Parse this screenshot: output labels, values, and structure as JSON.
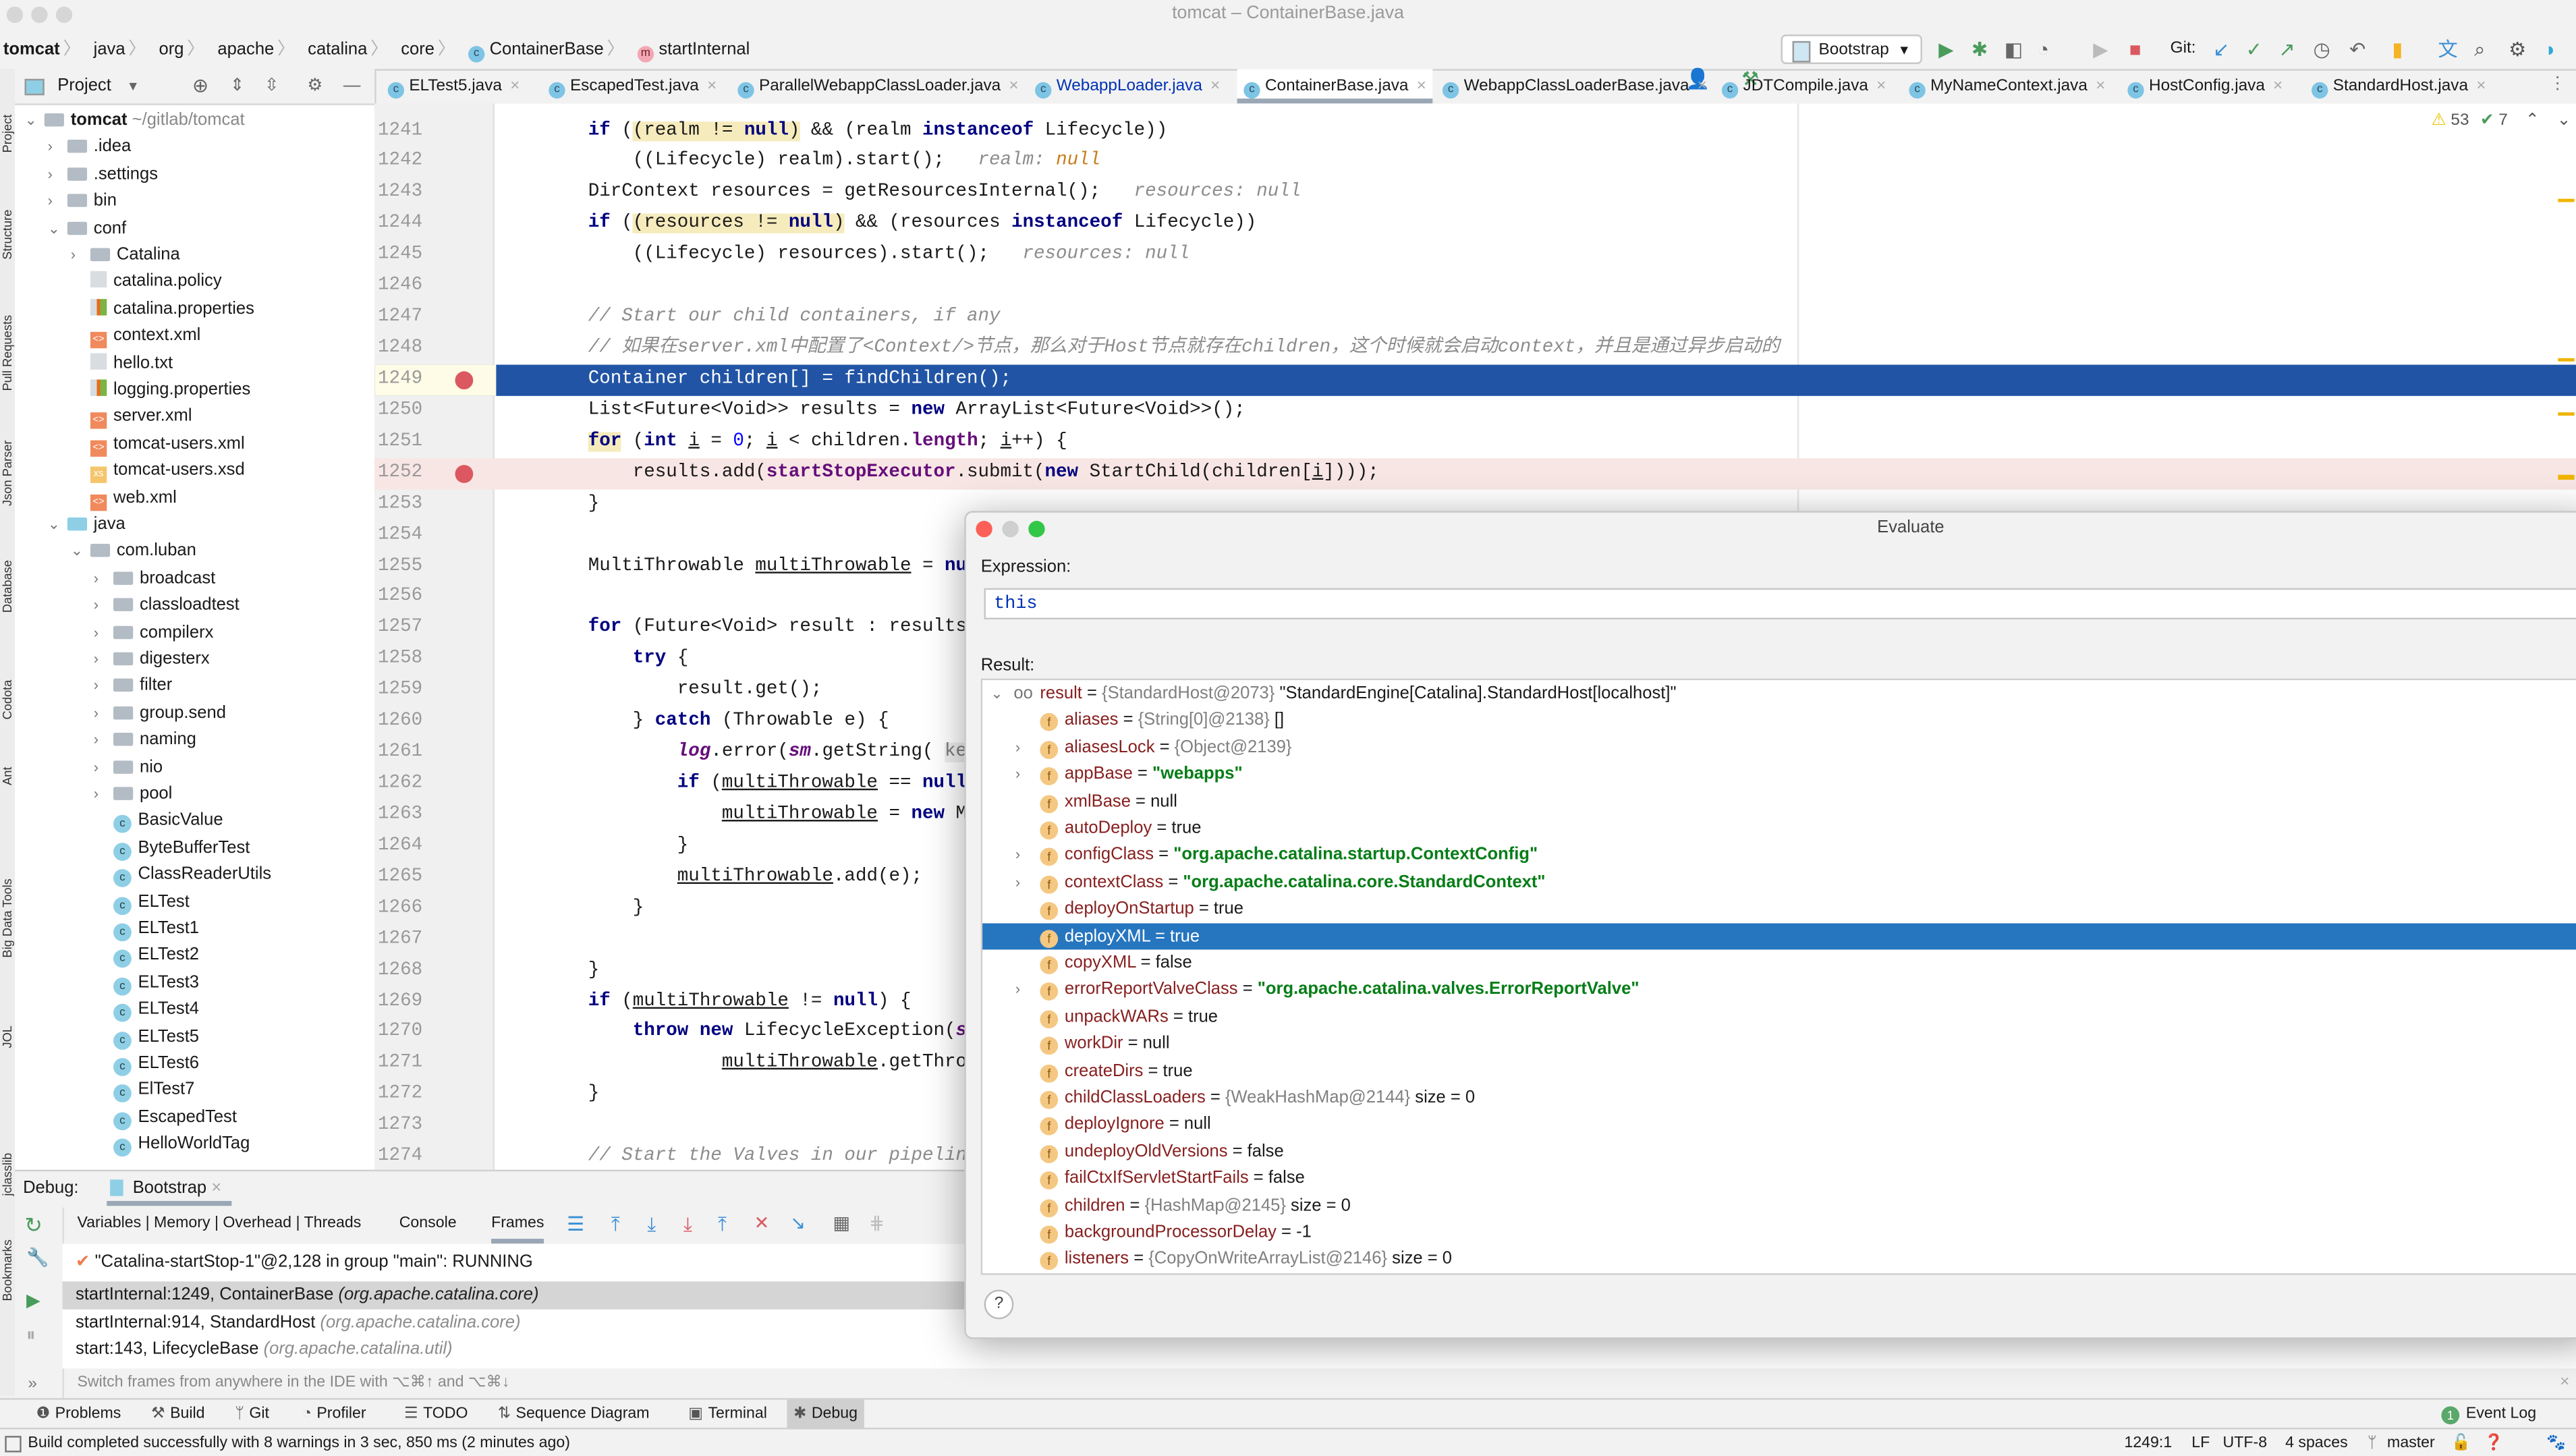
{
  "window": {
    "title": "tomcat – ContainerBase.java"
  },
  "breadcrumb": [
    {
      "label": "tomcat"
    },
    {
      "label": "java"
    },
    {
      "label": "org"
    },
    {
      "label": "apache"
    },
    {
      "label": "catalina"
    },
    {
      "label": "core"
    },
    {
      "label": "ContainerBase",
      "icon": "class-icon"
    },
    {
      "label": "startInternal",
      "icon": "method-icon"
    }
  ],
  "toolbar": {
    "run_config": "Bootstrap",
    "git_label": "Git:"
  },
  "left_strip": [
    "Project",
    "Structure",
    "Pull Requests",
    "Json Parser",
    "Database",
    "Codota",
    "Ant",
    "Big Data Tools",
    "JOL",
    "jclasslib",
    "Bookmarks"
  ],
  "project": {
    "title": "Project",
    "root": {
      "label": "tomcat",
      "path": "~/gitlab/tomcat"
    },
    "items": [
      {
        "label": ".idea",
        "depth": 1,
        "icon": "folder",
        "arrow": "›"
      },
      {
        "label": ".settings",
        "depth": 1,
        "icon": "folder",
        "arrow": "›"
      },
      {
        "label": "bin",
        "depth": 1,
        "icon": "folder",
        "arrow": "›"
      },
      {
        "label": "conf",
        "depth": 1,
        "icon": "folder",
        "arrow": "⌄"
      },
      {
        "label": "Catalina",
        "depth": 2,
        "icon": "folder",
        "arrow": "›"
      },
      {
        "label": "catalina.policy",
        "depth": 2,
        "icon": "file"
      },
      {
        "label": "catalina.properties",
        "depth": 2,
        "icon": "prop"
      },
      {
        "label": "context.xml",
        "depth": 2,
        "icon": "xml"
      },
      {
        "label": "hello.txt",
        "depth": 2,
        "icon": "file"
      },
      {
        "label": "logging.properties",
        "depth": 2,
        "icon": "prop"
      },
      {
        "label": "server.xml",
        "depth": 2,
        "icon": "xml"
      },
      {
        "label": "tomcat-users.xml",
        "depth": 2,
        "icon": "xml"
      },
      {
        "label": "tomcat-users.xsd",
        "depth": 2,
        "icon": "xsd"
      },
      {
        "label": "web.xml",
        "depth": 2,
        "icon": "xml"
      },
      {
        "label": "java",
        "depth": 1,
        "icon": "srcfolder",
        "arrow": "⌄"
      },
      {
        "label": "com.luban",
        "depth": 2,
        "icon": "folder",
        "arrow": "⌄"
      },
      {
        "label": "broadcast",
        "depth": 3,
        "icon": "folder",
        "arrow": "›"
      },
      {
        "label": "classloadtest",
        "depth": 3,
        "icon": "folder",
        "arrow": "›"
      },
      {
        "label": "compilerx",
        "depth": 3,
        "icon": "folder",
        "arrow": "›"
      },
      {
        "label": "digesterx",
        "depth": 3,
        "icon": "folder",
        "arrow": "›"
      },
      {
        "label": "filter",
        "depth": 3,
        "icon": "folder",
        "arrow": "›"
      },
      {
        "label": "group.send",
        "depth": 3,
        "icon": "folder",
        "arrow": "›"
      },
      {
        "label": "naming",
        "depth": 3,
        "icon": "folder",
        "arrow": "›"
      },
      {
        "label": "nio",
        "depth": 3,
        "icon": "folder",
        "arrow": "›"
      },
      {
        "label": "pool",
        "depth": 3,
        "icon": "folder",
        "arrow": "›"
      },
      {
        "label": "BasicValue",
        "depth": 3,
        "icon": "class"
      },
      {
        "label": "ByteBufferTest",
        "depth": 3,
        "icon": "class"
      },
      {
        "label": "ClassReaderUtils",
        "depth": 3,
        "icon": "class"
      },
      {
        "label": "ELTest",
        "depth": 3,
        "icon": "class"
      },
      {
        "label": "ELTest1",
        "depth": 3,
        "icon": "class"
      },
      {
        "label": "ELTest2",
        "depth": 3,
        "icon": "class"
      },
      {
        "label": "ELTest3",
        "depth": 3,
        "icon": "class"
      },
      {
        "label": "ELTest4",
        "depth": 3,
        "icon": "class"
      },
      {
        "label": "ELTest5",
        "depth": 3,
        "icon": "class"
      },
      {
        "label": "ELTest6",
        "depth": 3,
        "icon": "class"
      },
      {
        "label": "ElTest7",
        "depth": 3,
        "icon": "class"
      },
      {
        "label": "EscapedTest",
        "depth": 3,
        "icon": "class"
      },
      {
        "label": "HelloWorldTag",
        "depth": 3,
        "icon": "class"
      }
    ]
  },
  "tabs": [
    {
      "label": "ELTest5.java"
    },
    {
      "label": "EscapedTest.java"
    },
    {
      "label": "ParallelWebappClassLoader.java"
    },
    {
      "label": "WebappLoader.java",
      "modified": true
    },
    {
      "label": "ContainerBase.java",
      "active": true
    },
    {
      "label": "WebappClassLoaderBase.java"
    },
    {
      "label": "JDTCompile.java"
    },
    {
      "label": "MyNameContext.java"
    },
    {
      "label": "HostConfig.java"
    },
    {
      "label": "StandardHost.java"
    }
  ],
  "inspections": {
    "warnings": "53",
    "weak_warnings": "7"
  },
  "editor": {
    "lines": [
      {
        "n": "1241",
        "t": [
          [
            "if ",
            "k"
          ],
          [
            "(",
            ""
          ],
          [
            "(realm != ",
            "hl"
          ],
          [
            "null",
            "k hl"
          ],
          [
            ")",
            "hl"
          ],
          [
            " && (realm ",
            ""
          ],
          [
            "instanceof",
            "k"
          ],
          [
            " Lifecycle))",
            ""
          ]
        ]
      },
      {
        "n": "1242",
        "t": [
          [
            "    ((Lifecycle) realm).start();   ",
            ""
          ],
          [
            "realm: ",
            "hint"
          ],
          [
            "null",
            "hnull"
          ]
        ]
      },
      {
        "n": "1243",
        "t": [
          [
            "DirContext resources = getResourcesInternal();   ",
            ""
          ],
          [
            "resources: null",
            "hint"
          ]
        ]
      },
      {
        "n": "1244",
        "t": [
          [
            "if ",
            "k"
          ],
          [
            "(",
            ""
          ],
          [
            "(resources != ",
            "hl"
          ],
          [
            "null",
            "k hl"
          ],
          [
            ")",
            "hl"
          ],
          [
            " && (resources ",
            ""
          ],
          [
            "instanceof",
            "k"
          ],
          [
            " Lifecycle))",
            ""
          ]
        ]
      },
      {
        "n": "1245",
        "t": [
          [
            "    ((Lifecycle) resources).start();   ",
            ""
          ],
          [
            "resources: null",
            "hint"
          ]
        ]
      },
      {
        "n": "1246",
        "t": []
      },
      {
        "n": "1247",
        "t": [
          [
            "// Start our child containers, if any",
            "cm"
          ]
        ]
      },
      {
        "n": "1248",
        "t": [
          [
            "// 如果在server.xml中配置了<Context/>节点，那么对于Host节点就存在children，这个时候就会启动context，并且是通过异步启动的",
            "cm"
          ]
        ]
      },
      {
        "n": "1249",
        "t": [
          [
            "Container children[] = findChildren();",
            ""
          ]
        ],
        "current": true,
        "breakpoint": true
      },
      {
        "n": "1250",
        "t": [
          [
            "List<Future<Void>> results = ",
            ""
          ],
          [
            "new",
            "k"
          ],
          [
            " ArrayList<Future<Void>>();",
            ""
          ]
        ]
      },
      {
        "n": "1251",
        "t": [
          [
            "for",
            "k hl"
          ],
          [
            " (",
            ""
          ],
          [
            "int",
            "k"
          ],
          [
            " ",
            ""
          ],
          [
            "i",
            "ul"
          ],
          [
            " = ",
            ""
          ],
          [
            "0",
            "num0"
          ],
          [
            "; ",
            ""
          ],
          [
            "i",
            "ul"
          ],
          [
            " < children.",
            ""
          ],
          [
            "length",
            "fld"
          ],
          [
            "; ",
            ""
          ],
          [
            "i",
            "ul"
          ],
          [
            "++) {",
            ""
          ]
        ]
      },
      {
        "n": "1252",
        "t": [
          [
            "    results.add(",
            ""
          ],
          [
            "startStopExecutor",
            "fld"
          ],
          [
            ".submit(",
            ""
          ],
          [
            "new",
            "k"
          ],
          [
            " StartChild(children[",
            ""
          ],
          [
            "i",
            "ul"
          ],
          [
            "])));",
            ""
          ]
        ],
        "breakpoint": true
      },
      {
        "n": "1253",
        "t": [
          [
            "}",
            ""
          ]
        ]
      },
      {
        "n": "1254",
        "t": []
      },
      {
        "n": "1255",
        "t": [
          [
            "MultiThrowable ",
            ""
          ],
          [
            "multiThrowable",
            "ul"
          ],
          [
            " = ",
            ""
          ],
          [
            "nul",
            "k"
          ]
        ]
      },
      {
        "n": "1256",
        "t": []
      },
      {
        "n": "1257",
        "t": [
          [
            "for",
            "k"
          ],
          [
            " (Future<Void> result : results)",
            ""
          ]
        ]
      },
      {
        "n": "1258",
        "t": [
          [
            "    ",
            ""
          ],
          [
            "try",
            "k"
          ],
          [
            " {",
            ""
          ]
        ]
      },
      {
        "n": "1259",
        "t": [
          [
            "        result.get();",
            ""
          ]
        ]
      },
      {
        "n": "1260",
        "t": [
          [
            "    } ",
            ""
          ],
          [
            "catch",
            "k"
          ],
          [
            " (Throwable e) {",
            ""
          ]
        ]
      },
      {
        "n": "1261",
        "t": [
          [
            "        ",
            ""
          ],
          [
            "log",
            "sfld"
          ],
          [
            ".error(",
            ""
          ],
          [
            "sm",
            "sfld"
          ],
          [
            ".getString( ",
            ""
          ],
          [
            "key",
            "pin"
          ]
        ]
      },
      {
        "n": "1262",
        "t": [
          [
            "        ",
            ""
          ],
          [
            "if",
            "k"
          ],
          [
            " (",
            ""
          ],
          [
            "multiThrowable",
            "ul"
          ],
          [
            " == ",
            ""
          ],
          [
            "null",
            "k"
          ],
          [
            ")",
            ""
          ]
        ]
      },
      {
        "n": "1263",
        "t": [
          [
            "            ",
            ""
          ],
          [
            "multiThrowable",
            "ul"
          ],
          [
            " = ",
            ""
          ],
          [
            "new",
            "k"
          ],
          [
            " Mu",
            ""
          ]
        ]
      },
      {
        "n": "1264",
        "t": [
          [
            "        }",
            ""
          ]
        ]
      },
      {
        "n": "1265",
        "t": [
          [
            "        ",
            ""
          ],
          [
            "multiThrowable",
            "ul"
          ],
          [
            ".add(e);",
            ""
          ]
        ]
      },
      {
        "n": "1266",
        "t": [
          [
            "    }",
            ""
          ]
        ]
      },
      {
        "n": "1267",
        "t": []
      },
      {
        "n": "1268",
        "t": [
          [
            "}",
            ""
          ]
        ]
      },
      {
        "n": "1269",
        "t": [
          [
            "if",
            "k"
          ],
          [
            " (",
            ""
          ],
          [
            "multiThrowable",
            "ul"
          ],
          [
            " != ",
            ""
          ],
          [
            "null",
            "k"
          ],
          [
            ") {",
            ""
          ]
        ]
      },
      {
        "n": "1270",
        "t": [
          [
            "    ",
            ""
          ],
          [
            "throw new",
            "k"
          ],
          [
            " LifecycleException(",
            ""
          ],
          [
            "sm",
            "sfld"
          ]
        ]
      },
      {
        "n": "1271",
        "t": [
          [
            "            ",
            ""
          ],
          [
            "multiThrowable",
            "ul"
          ],
          [
            ".getThrow",
            ""
          ]
        ]
      },
      {
        "n": "1272",
        "t": [
          [
            "}",
            ""
          ]
        ]
      },
      {
        "n": "1273",
        "t": []
      },
      {
        "n": "1274",
        "t": [
          [
            "// Start the Valves in our pipeline",
            "cm"
          ]
        ]
      }
    ]
  },
  "debug": {
    "label": "Debug:",
    "session": "Bootstrap",
    "tabs": {
      "variables": "Variables | Memory | Overhead | Threads",
      "console": "Console",
      "frames": "Frames"
    },
    "thread": "\"Catalina-startStop-1\"@2,128 in group \"main\": RUNNING",
    "frames": [
      {
        "method": "startInternal:1249, ContainerBase",
        "pkg": "(org.apache.catalina.core)",
        "selected": true
      },
      {
        "method": "startInternal:914, StandardHost",
        "pkg": "(org.apache.catalina.core)"
      },
      {
        "method": "start:143, LifecycleBase",
        "pkg": "(org.apache.catalina.util)"
      }
    ],
    "hint": "Switch frames from anywhere in the IDE with ⌥⌘↑ and ⌥⌘↓"
  },
  "bottom_tabs": [
    {
      "label": "Problems",
      "icon": "problems-icon"
    },
    {
      "label": "Build",
      "icon": "hammer-icon"
    },
    {
      "label": "Git",
      "icon": "git-icon"
    },
    {
      "label": "Profiler",
      "icon": "profiler-icon"
    },
    {
      "label": "TODO",
      "icon": "list-icon"
    },
    {
      "label": "Sequence Diagram",
      "icon": "sequence-icon"
    },
    {
      "label": "Terminal",
      "icon": "terminal-icon"
    },
    {
      "label": "Debug",
      "icon": "bug-icon",
      "active": true
    }
  ],
  "event_log": {
    "count": "1",
    "label": "Event Log"
  },
  "status": {
    "message": "Build completed successfully with 8 warnings in 3 sec, 850 ms (2 minutes ago)",
    "position": "1249:1",
    "line_sep": "LF",
    "encoding": "UTF-8",
    "indent": "4 spaces",
    "branch": "master"
  },
  "evaluate": {
    "title": "Evaluate",
    "expression_label": "Expression:",
    "expression": "this",
    "result_label": "Result:",
    "root": {
      "name": "result",
      "ref": "{StandardHost@2073}",
      "value": "\"StandardEngine[Catalina].StandardHost[localhost]\""
    },
    "fields": [
      {
        "name": "aliases",
        "ref": "{String[0]@2138}",
        "value": "[]",
        "type": "plain"
      },
      {
        "name": "aliasesLock",
        "ref": "{Object@2139}",
        "type": "ref",
        "expandable": true
      },
      {
        "name": "appBase",
        "value": "\"webapps\"",
        "type": "str",
        "expandable": true
      },
      {
        "name": "xmlBase",
        "value": "null",
        "type": "plain"
      },
      {
        "name": "autoDeploy",
        "value": "true",
        "type": "plain"
      },
      {
        "name": "configClass",
        "value": "\"org.apache.catalina.startup.ContextConfig\"",
        "type": "str",
        "expandable": true
      },
      {
        "name": "contextClass",
        "value": "\"org.apache.catalina.core.StandardContext\"",
        "type": "str",
        "expandable": true
      },
      {
        "name": "deployOnStartup",
        "value": "true",
        "type": "plain"
      },
      {
        "name": "deployXML",
        "value": "true",
        "type": "plain",
        "selected": true
      },
      {
        "name": "copyXML",
        "value": "false",
        "type": "plain"
      },
      {
        "name": "errorReportValveClass",
        "value": "\"org.apache.catalina.valves.ErrorReportValve\"",
        "type": "str",
        "expandable": true
      },
      {
        "name": "unpackWARs",
        "value": "true",
        "type": "plain"
      },
      {
        "name": "workDir",
        "value": "null",
        "type": "plain"
      },
      {
        "name": "createDirs",
        "value": "true",
        "type": "plain"
      },
      {
        "name": "childClassLoaders",
        "ref": "{WeakHashMap@2144}",
        "value": "size = 0",
        "type": "plain"
      },
      {
        "name": "deployIgnore",
        "value": "null",
        "type": "plain"
      },
      {
        "name": "undeployOldVersions",
        "value": "false",
        "type": "plain"
      },
      {
        "name": "failCtxIfServletStartFails",
        "value": "false",
        "type": "plain"
      },
      {
        "name": "children",
        "ref": "{HashMap@2145}",
        "value": "size = 0",
        "type": "plain"
      },
      {
        "name": "backgroundProcessorDelay",
        "value": "-1",
        "type": "plain"
      },
      {
        "name": "listeners",
        "ref": "{CopyOnWriteArrayList@2146}",
        "value": "size = 0",
        "type": "plain"
      }
    ],
    "help": "?"
  },
  "colors": {
    "accent": "#2154a5",
    "selection": "#2675bf",
    "breakpoint": "#db5860",
    "string": "#067d17",
    "keyword": "#000080"
  }
}
